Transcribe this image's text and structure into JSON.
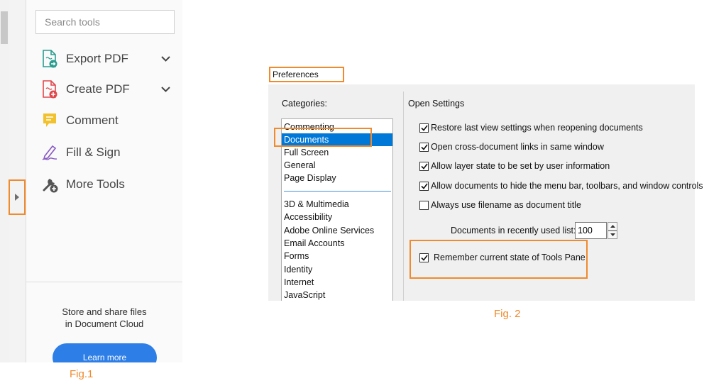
{
  "colors": {
    "annotation_orange": "#f08a2c",
    "selection_blue": "#0078d7",
    "learn_more_blue": "#2d7ee6"
  },
  "fig1": {
    "caption": "Fig.1",
    "search": {
      "placeholder": "Search tools"
    },
    "tools": [
      {
        "label": "Export PDF",
        "icon": "export-pdf-icon",
        "expandable": true
      },
      {
        "label": "Create PDF",
        "icon": "create-pdf-icon",
        "expandable": true
      },
      {
        "label": "Comment",
        "icon": "comment-icon",
        "expandable": false
      },
      {
        "label": "Fill & Sign",
        "icon": "fill-sign-icon",
        "expandable": false
      },
      {
        "label": "More Tools",
        "icon": "more-tools-icon",
        "expandable": false
      }
    ],
    "cloud_promo": {
      "line1": "Store and share files",
      "line2": "in Document Cloud",
      "button": "Learn more"
    }
  },
  "fig2": {
    "caption": "Fig. 2",
    "dialog_title": "Preferences",
    "categories_label": "Categories:",
    "categories": [
      "Commenting",
      "Documents",
      "Full Screen",
      "General",
      "Page Display",
      "3D & Multimedia",
      "Accessibility",
      "Adobe Online Services",
      "Email Accounts",
      "Forms",
      "Identity",
      "Internet",
      "JavaScript"
    ],
    "selected_category": "Documents",
    "open_settings": {
      "heading": "Open Settings",
      "options": [
        {
          "label": "Restore last view settings when reopening documents",
          "checked": true
        },
        {
          "label": "Open cross-document links in same window",
          "checked": true
        },
        {
          "label": "Allow layer state to be set by user information",
          "checked": true
        },
        {
          "label": "Allow documents to hide the menu bar, toolbars, and window controls",
          "checked": true
        },
        {
          "label": "Always use filename as document title",
          "checked": false
        }
      ],
      "recent_list_label": "Documents in recently used list:",
      "recent_list_value": "100",
      "tools_pane_option": {
        "label": "Remember current state of Tools Pane",
        "checked": true
      }
    }
  }
}
